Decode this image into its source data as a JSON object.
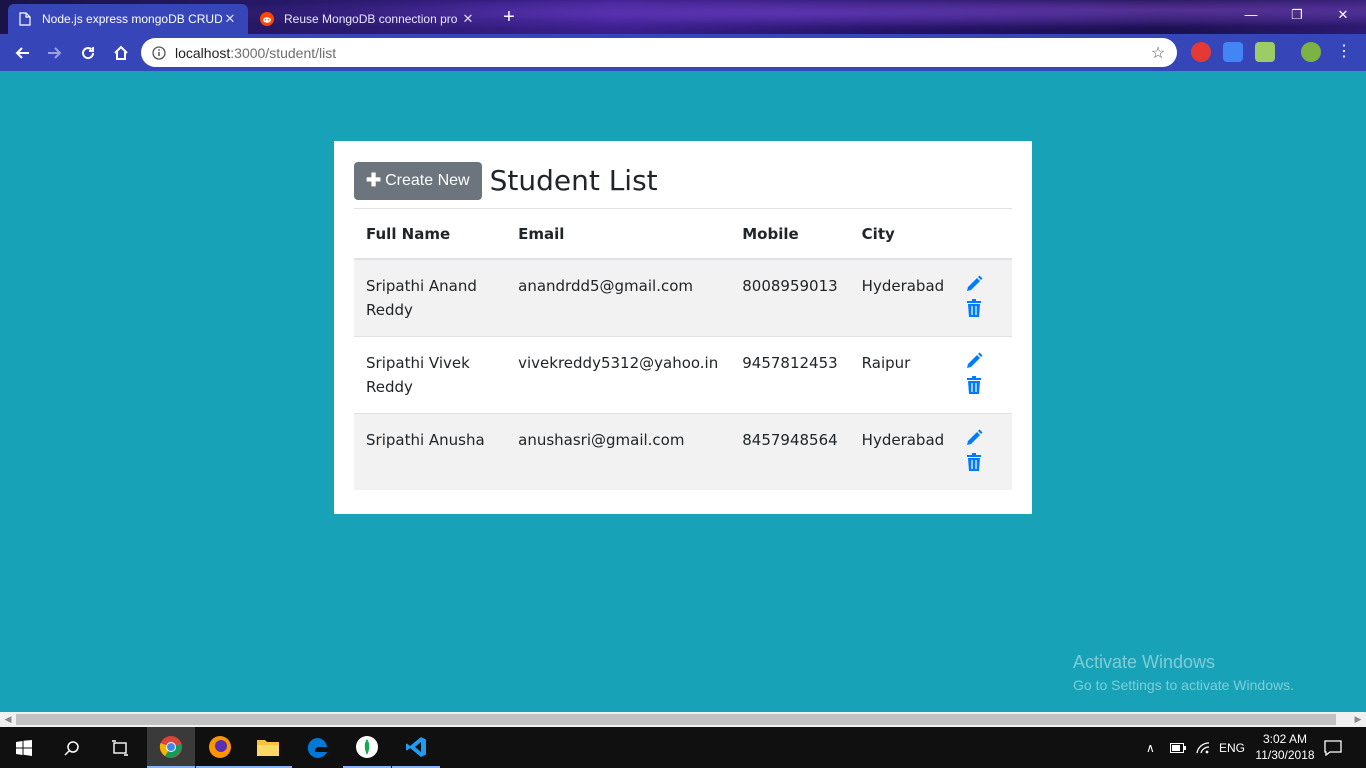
{
  "browser": {
    "tabs": [
      {
        "title": "Node.js express mongoDB CRUD",
        "active": true
      },
      {
        "title": "Reuse MongoDB connection pro",
        "active": false
      }
    ],
    "url_host": "localhost",
    "url_path": ":3000/student/list"
  },
  "page": {
    "create_button": "Create New",
    "title": "Student List",
    "columns": [
      "Full Name",
      "Email",
      "Mobile",
      "City"
    ],
    "students": [
      {
        "name": "Sripathi Anand Reddy",
        "email": "anandrdd5@gmail.com",
        "mobile": "8008959013",
        "city": "Hyderabad"
      },
      {
        "name": "Sripathi Vivek Reddy",
        "email": "vivekreddy5312@yahoo.in",
        "mobile": "9457812453",
        "city": "Raipur"
      },
      {
        "name": "Sripathi Anusha",
        "email": "anushasri@gmail.com",
        "mobile": "8457948564",
        "city": "Hyderabad"
      }
    ],
    "accent_color": "#007bff",
    "background_color": "#17a2b8"
  },
  "watermark": {
    "line1": "Activate Windows",
    "line2": "Go to Settings to activate Windows."
  },
  "taskbar": {
    "language": "ENG",
    "time": "3:02 AM",
    "date": "11/30/2018"
  }
}
